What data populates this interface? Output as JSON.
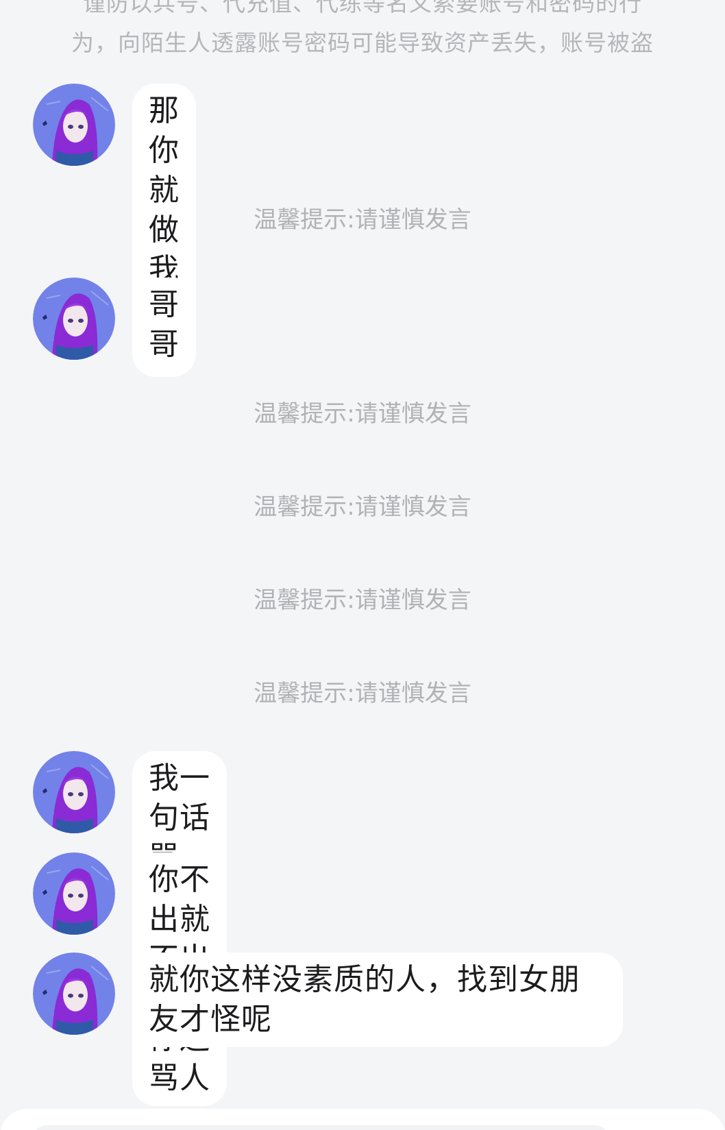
{
  "notice": {
    "line1": "谨防以兵号、代充值、代练等名义索要账号和密码的行",
    "line2": "为，向陌生人透露账号密码可能导致资产丢失，账号被盗"
  },
  "messages": [
    {
      "text": "那你就做我哥哥"
    },
    {
      "text": "哥哥"
    },
    {
      "text": "我一句话骂了，你骂我三条"
    },
    {
      "text": "你不出就不出吧，你还骂人"
    },
    {
      "text": "就你这样没素质的人，找到女朋友才怪呢"
    }
  ],
  "tips": [
    {
      "text": "温馨提示:请谨慎发言"
    },
    {
      "text": "温馨提示:请谨慎发言"
    },
    {
      "text": "温馨提示:请谨慎发言"
    },
    {
      "text": "温馨提示:请谨慎发言"
    },
    {
      "text": "温馨提示:请谨慎发言"
    }
  ],
  "avatar_icon": "anime-girl-purple-hair-avatar",
  "colors": {
    "background": "#f4f5f7",
    "bubble": "#ffffff",
    "tip_text": "#b0b2b6",
    "avatar_bg": "#6f7fe6",
    "hair": "#8a2bd6"
  }
}
